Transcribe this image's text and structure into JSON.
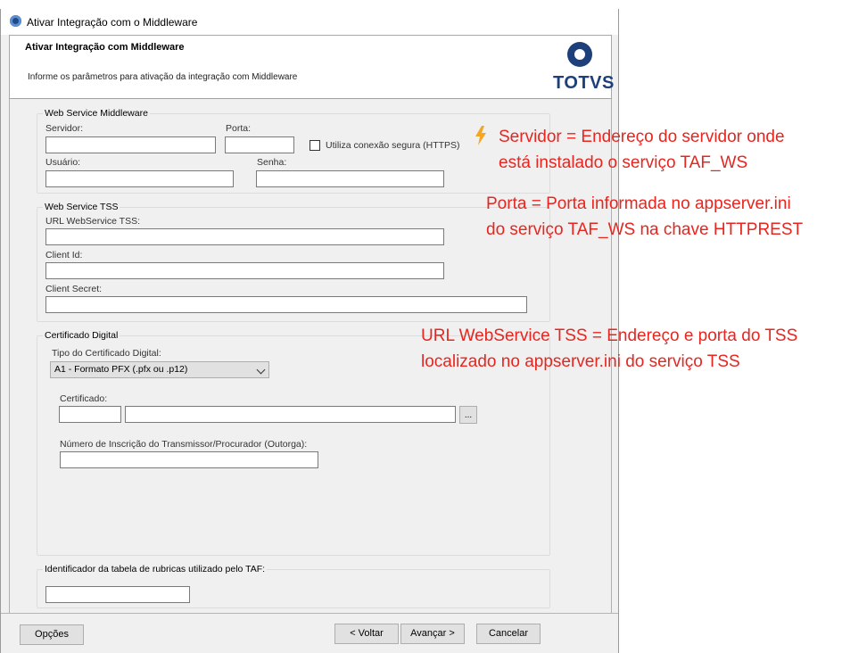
{
  "window": {
    "title": "Ativar Integração com o Middleware"
  },
  "header": {
    "title": "Ativar Integração com Middleware",
    "subtitle": "Informe os parâmetros para ativação da integração com Middleware",
    "logo_text": "TOTVS"
  },
  "ws_middleware": {
    "legend": "Web Service Middleware",
    "servidor_label": "Servidor:",
    "porta_label": "Porta:",
    "https_label": "Utiliza conexão segura (HTTPS)",
    "usuario_label": "Usuário:",
    "senha_label": "Senha:"
  },
  "ws_tss": {
    "legend": "Web Service TSS",
    "url_label": "URL WebService TSS:",
    "client_id_label": "Client Id:",
    "client_secret_label": "Client Secret:"
  },
  "certificado": {
    "legend": "Certificado Digital",
    "tipo_label": "Tipo do Certificado Digital:",
    "tipo_value": "A1 - Formato PFX (.pfx ou .p12)",
    "cert_label": "Certificado:",
    "browse_label": "...",
    "numero_label": "Número de Inscrição do Transmissor/Procurador (Outorga):"
  },
  "rubricas": {
    "legend": "Identificador da tabela de rubricas utilizado pelo TAF:"
  },
  "footer": {
    "opcoes": "Opções",
    "voltar": "< Voltar",
    "avancar": "Avançar >",
    "cancelar": "Cancelar"
  },
  "annotations": {
    "servidor_line1": "Servidor = Endereço do servidor onde",
    "servidor_line2": "está instalado o serviço TAF_WS",
    "porta_line1": "Porta = Porta informada no appserver.ini",
    "porta_line2": "do serviço TAF_WS na chave HTTPREST",
    "url_line1": "URL WebService TSS = Endereço e porta do TSS",
    "url_line2": "localizado no appserver.ini do serviço TSS"
  },
  "colors": {
    "annotation": "#e8251f",
    "brand": "#1d3f7a",
    "bolt": "#f5a623"
  }
}
